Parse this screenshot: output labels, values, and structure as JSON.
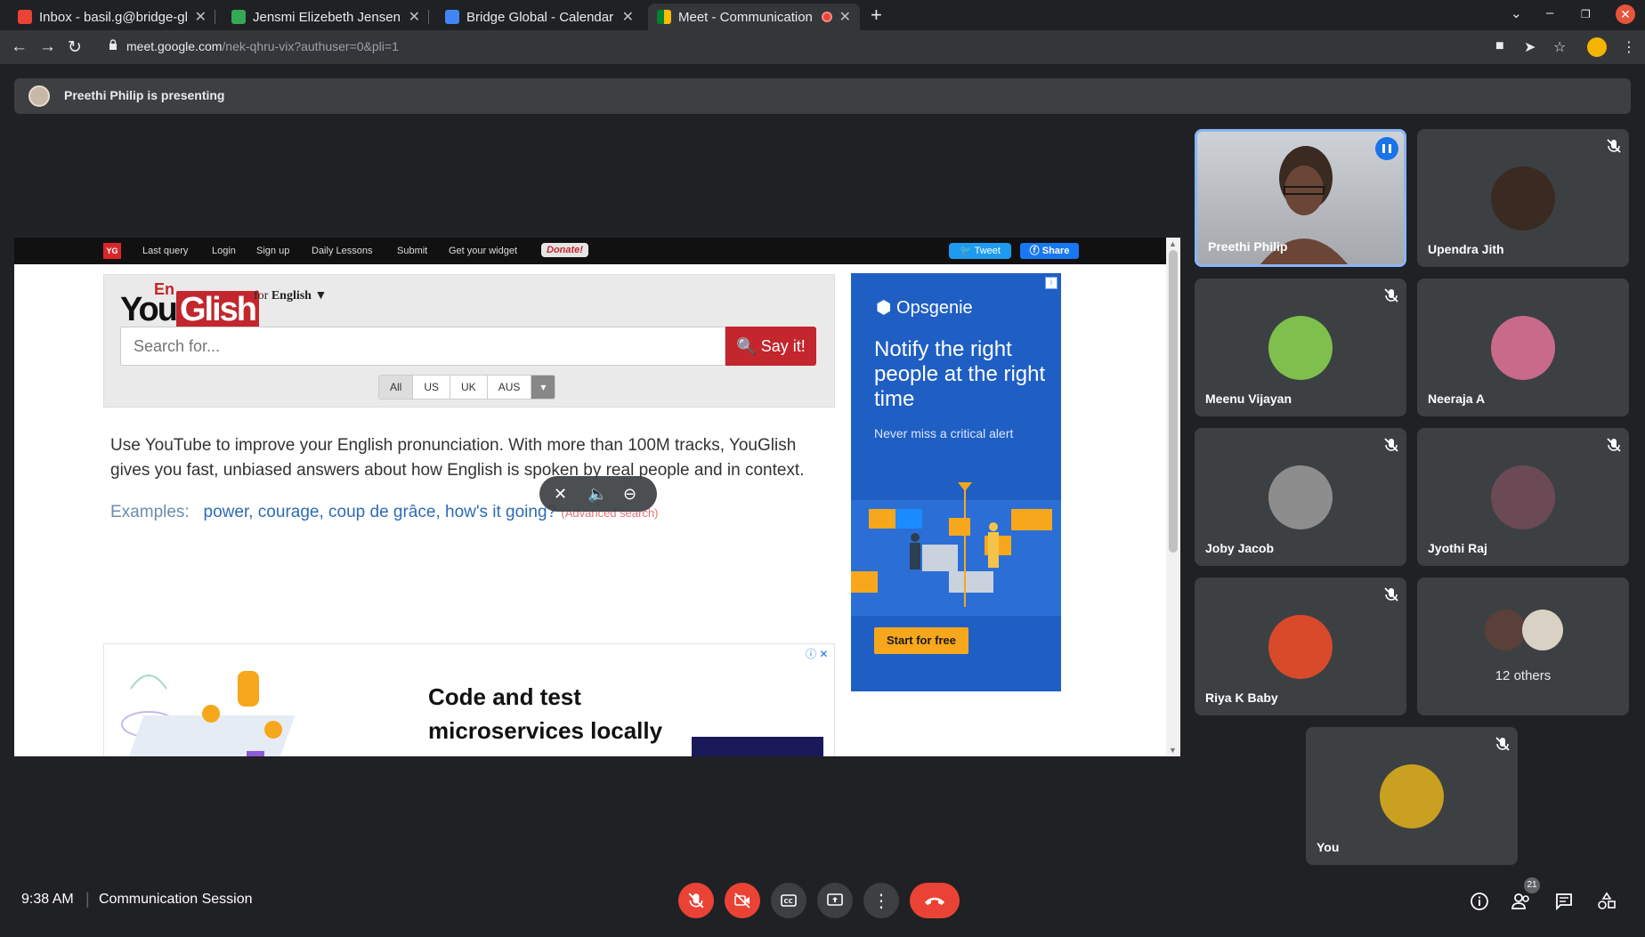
{
  "browser": {
    "tabs": [
      {
        "title": "Inbox - basil.g@bridge-gl",
        "favicon_color": "#ea4335"
      },
      {
        "title": "Jensmi Elizebeth Jensen",
        "favicon_color": "#34a853"
      },
      {
        "title": "Bridge Global - Calendar",
        "favicon_color": "#4285f4"
      },
      {
        "title": "Meet - Communication",
        "favicon_color": "#00832d",
        "active": true
      }
    ],
    "url_host": "meet.google.com",
    "url_path": "/nek-qhru-vix?authuser=0&pli=1"
  },
  "presenting": {
    "text": "Preethi Philip is presenting"
  },
  "youglish": {
    "nav": [
      "Last query",
      "Login",
      "Sign up",
      "Daily Lessons",
      "Submit",
      "Get your widget"
    ],
    "logo_small": "YG",
    "donate": "Donate!",
    "tweet": "Tweet",
    "share": "Share",
    "logo_en": "En",
    "logo_you": "You",
    "logo_glish": "Glish",
    "lang_prefix": "for",
    "lang": "English",
    "search_placeholder": "Search for...",
    "say_it": "Say it!",
    "accents": [
      "All",
      "US",
      "UK",
      "AUS"
    ],
    "description": "Use YouTube to improve your English pronunciation. With more than 100M tracks, YouGlish gives you fast, unbiased answers about how English is spoken by real people and in context.",
    "examples_label": "Examples:",
    "examples": "power, courage, coup de grâce, how's it going?",
    "advanced": "(Advanced search)"
  },
  "ad_opsgenie": {
    "brand": "Opsgenie",
    "headline": "Notify the right people at the right time",
    "sub": "Never miss a critical alert",
    "cta": "Start for free"
  },
  "ad_bottom": {
    "title": "Code and test microservices locally"
  },
  "participants": [
    {
      "name": "Preethi Philip",
      "speaking": true
    },
    {
      "name": "Upendra Jith",
      "muted": true,
      "avatar_color": "#3a2a22"
    },
    {
      "name": "Meenu Vijayan",
      "muted": true,
      "avatar_color": "#7fbf4d"
    },
    {
      "name": "Neeraja A",
      "muted": false,
      "avatar_color": "#c96a8a"
    },
    {
      "name": "Joby Jacob",
      "muted": true,
      "avatar_color": "#8d8d8d"
    },
    {
      "name": "Jyothi Raj",
      "muted": true,
      "avatar_color": "#6b4a55"
    },
    {
      "name": "Riya K Baby",
      "muted": true,
      "avatar_color": "#d84a2a"
    },
    {
      "name": "12 others"
    },
    {
      "name": "You",
      "muted": true,
      "avatar_color": "#c9a020"
    }
  ],
  "bottom": {
    "time": "9:38 AM",
    "separator": "|",
    "meeting": "Communication Session",
    "people_count": "21"
  }
}
